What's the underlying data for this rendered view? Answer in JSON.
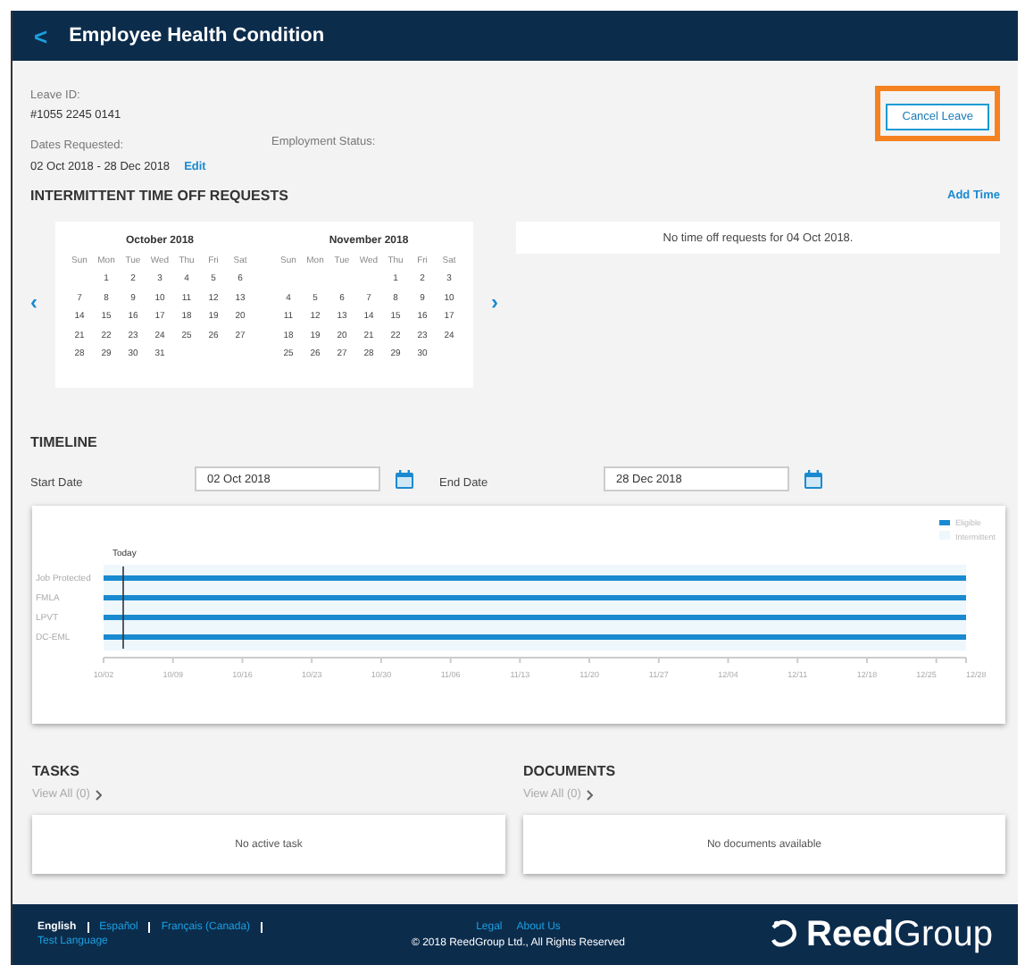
{
  "header": {
    "back": "<",
    "title": "Employee Health Condition"
  },
  "details": {
    "leave_id_label": "Leave ID:",
    "leave_id": "#1055 2245 0141",
    "dates_label": "Dates Requested:",
    "dates": "02 Oct 2018 - 28 Dec 2018",
    "edit": "Edit",
    "employment_label": "Employment Status:"
  },
  "cancel_button": "Cancel Leave",
  "intermittent": {
    "title": "INTERMITTENT TIME OFF REQUESTS",
    "add": "Add Time",
    "prev": "‹",
    "next": "›",
    "notice": "No time off requests for 04 Oct 2018.",
    "months": [
      {
        "title": "October 2018",
        "weekdays": [
          "Sun",
          "Mon",
          "Tue",
          "Wed",
          "Thu",
          "Fri",
          "Sat"
        ],
        "weeks": [
          {
            "kind": "first",
            "days": [
              "1",
              "2",
              "3",
              "4",
              "5",
              "6"
            ]
          },
          {
            "kind": "middle",
            "days": [
              "7",
              "8",
              "9",
              "10",
              "11",
              "12",
              "13"
            ]
          },
          {
            "kind": "middle",
            "days": [
              "14",
              "15",
              "16",
              "17",
              "18",
              "19",
              "20"
            ]
          },
          {
            "kind": "middle",
            "days": [
              "21",
              "22",
              "23",
              "24",
              "25",
              "26",
              "27"
            ]
          },
          {
            "kind": "last",
            "days": [
              "28",
              "29",
              "30",
              "31"
            ]
          }
        ]
      },
      {
        "title": "November 2018",
        "weekdays": [
          "Sun",
          "Mon",
          "Tue",
          "Wed",
          "Thu",
          "Fri",
          "Sat"
        ],
        "weeks": [
          {
            "kind": "first",
            "days": [
              "1",
              "2",
              "3"
            ]
          },
          {
            "kind": "middle",
            "days": [
              "4",
              "5",
              "6",
              "7",
              "8",
              "9",
              "10"
            ]
          },
          {
            "kind": "middle",
            "days": [
              "11",
              "12",
              "13",
              "14",
              "15",
              "16",
              "17"
            ]
          },
          {
            "kind": "middle",
            "days": [
              "18",
              "19",
              "20",
              "21",
              "22",
              "23",
              "24"
            ]
          },
          {
            "kind": "last",
            "days": [
              "25",
              "26",
              "27",
              "28",
              "29",
              "30"
            ]
          }
        ]
      }
    ]
  },
  "timeline": {
    "title": "TIMELINE",
    "start_label": "Start Date",
    "start": "02 Oct 2018",
    "end_label": "End Date",
    "end": "28 Dec 2018",
    "legend": [
      "Eligible",
      "Intermittent"
    ],
    "today": "Today",
    "rows": [
      "Job Protected",
      "FMLA",
      "LPVT",
      "DC-EML"
    ],
    "ticks": [
      "10/02",
      "10/09",
      "10/16",
      "10/23",
      "10/30",
      "11/06",
      "11/13",
      "11/20",
      "11/27",
      "12/04",
      "12/11",
      "12/18",
      "12/25",
      "12/28"
    ]
  },
  "panels": [
    {
      "title": "TASKS",
      "link": "View All (0)",
      "empty": "No active task"
    },
    {
      "title": "DOCUMENTS",
      "link": "View All (0)",
      "empty": "No documents available"
    }
  ],
  "footer": {
    "languages": [
      {
        "label": "English",
        "selected": true
      },
      {
        "label": "Español",
        "selected": false
      },
      {
        "label": "Français (Canada)",
        "selected": false
      },
      {
        "label": "Test Language",
        "selected": false
      }
    ],
    "links": [
      "Legal",
      "About Us"
    ],
    "copyright": "© 2018 ReedGroup Ltd., All Rights Reserved",
    "logo_bold": "Reed",
    "logo_light": "Group"
  }
}
